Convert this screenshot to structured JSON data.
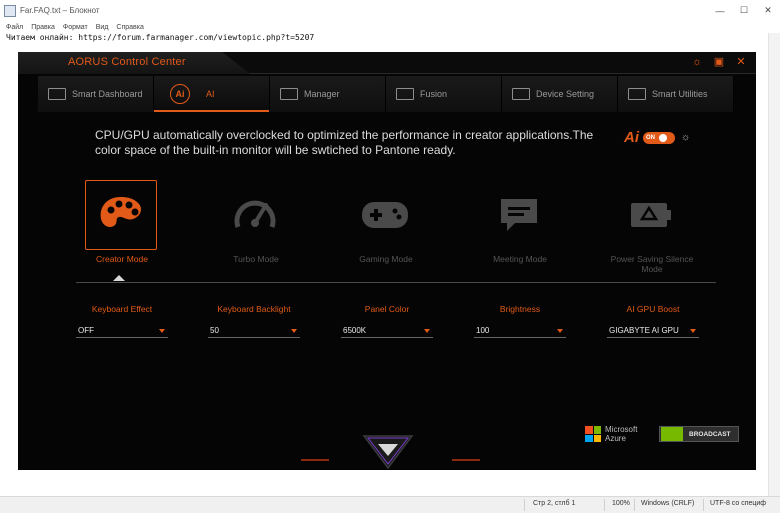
{
  "notepad": {
    "title": "Far.FAQ.txt – Блокнот",
    "menu": [
      "Файл",
      "Правка",
      "Формат",
      "Вид",
      "Справка"
    ],
    "text_line": "Читаем онлайн: https://forum.farmanager.com/viewtopic.php?t=5207",
    "status": {
      "position": "Стр 2, стлб 1",
      "zoom": "100%",
      "line_endings": "Windows (CRLF)",
      "encoding": "UTF-8 со специф"
    }
  },
  "app": {
    "title": "AORUS Control Center",
    "controls": [
      {
        "name": "settings-icon",
        "glyph": "☼"
      },
      {
        "name": "restore-icon",
        "glyph": "▣"
      },
      {
        "name": "close-icon",
        "glyph": "✕"
      }
    ],
    "tabs": [
      {
        "label": "Smart Dashboard",
        "icon": "dashboard-icon"
      },
      {
        "label": "AI",
        "icon": "ai-icon"
      },
      {
        "label": "Manager",
        "icon": "keyboard-grid-icon"
      },
      {
        "label": "Fusion",
        "icon": "keyboard-icon"
      },
      {
        "label": "Device Setting",
        "icon": "laptop-icon"
      },
      {
        "label": "Smart Utilities",
        "icon": "utilities-icon"
      }
    ],
    "active_tab": "AI",
    "description": "CPU/GPU automatically overclocked to optimized the performance in creator applications.The color space of the built-in monitor will be swtiched to Pantone ready.",
    "ai_toggle": {
      "logo": "Ai",
      "state": "ON"
    },
    "modes": [
      {
        "label": "Creator Mode",
        "icon": "palette-icon",
        "active": true
      },
      {
        "label": "Turbo Mode",
        "icon": "speedometer-icon",
        "active": false
      },
      {
        "label": "Gaming Mode",
        "icon": "gamepad-icon",
        "active": false
      },
      {
        "label": "Meeting Mode",
        "icon": "chat-icon",
        "active": false
      },
      {
        "label": "Power Saving Silence Mode",
        "icon": "battery-recycle-icon",
        "active": false
      }
    ],
    "settings": [
      {
        "label": "Keyboard Effect",
        "value": "OFF"
      },
      {
        "label": "Keyboard Backlight",
        "value": "50"
      },
      {
        "label": "Panel Color",
        "value": "6500K"
      },
      {
        "label": "Brightness",
        "value": "100"
      },
      {
        "label": "AI GPU Boost",
        "value": "GIGABYTE AI GPU"
      }
    ],
    "partners": {
      "microsoft": "Microsoft Azure",
      "nvidia": "BROADCAST"
    },
    "colors": {
      "accent": "#e25a18",
      "background": "#050505",
      "inactive": "#555555"
    }
  }
}
